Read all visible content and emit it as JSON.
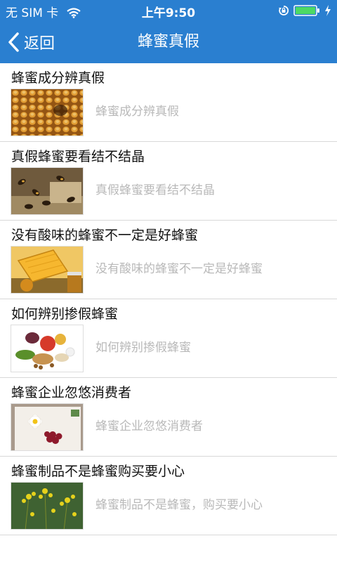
{
  "status_bar": {
    "carrier": "无 SIM 卡",
    "time": "上午9:50",
    "wifi_icon": "wifi-icon",
    "rotation_lock_icon": "rotation-lock-icon",
    "battery_icon": "battery-icon",
    "charging_icon": "charging-bolt-icon"
  },
  "nav": {
    "back_label": "返回",
    "title": "蜂蜜真假",
    "accent_color": "#2a7fd0"
  },
  "items": [
    {
      "title": "蜂蜜成分辨真假",
      "desc": "蜂蜜成分辨真假",
      "thumb": "honeycomb"
    },
    {
      "title": "真假蜂蜜要看结不结晶",
      "desc": "真假蜂蜜要看结不结晶",
      "thumb": "bees-on-comb"
    },
    {
      "title": "没有酸味的蜂蜜不一定是好蜂蜜",
      "desc": "没有酸味的蜂蜜不一定是好蜂蜜",
      "thumb": "honeycomb-and-jar"
    },
    {
      "title": "如何辨别掺假蜂蜜",
      "desc": "如何辨别掺假蜂蜜",
      "thumb": "fruits-and-nuts"
    },
    {
      "title": "蜂蜜企业忽悠消费者",
      "desc": "蜂蜜企业忽悠消费者",
      "thumb": "flower-and-berries"
    },
    {
      "title": "蜂蜜制品不是蜂蜜购买要小心",
      "desc": "蜂蜜制品不是蜂蜜，购买要小心",
      "thumb": "yellow-flowers"
    }
  ]
}
